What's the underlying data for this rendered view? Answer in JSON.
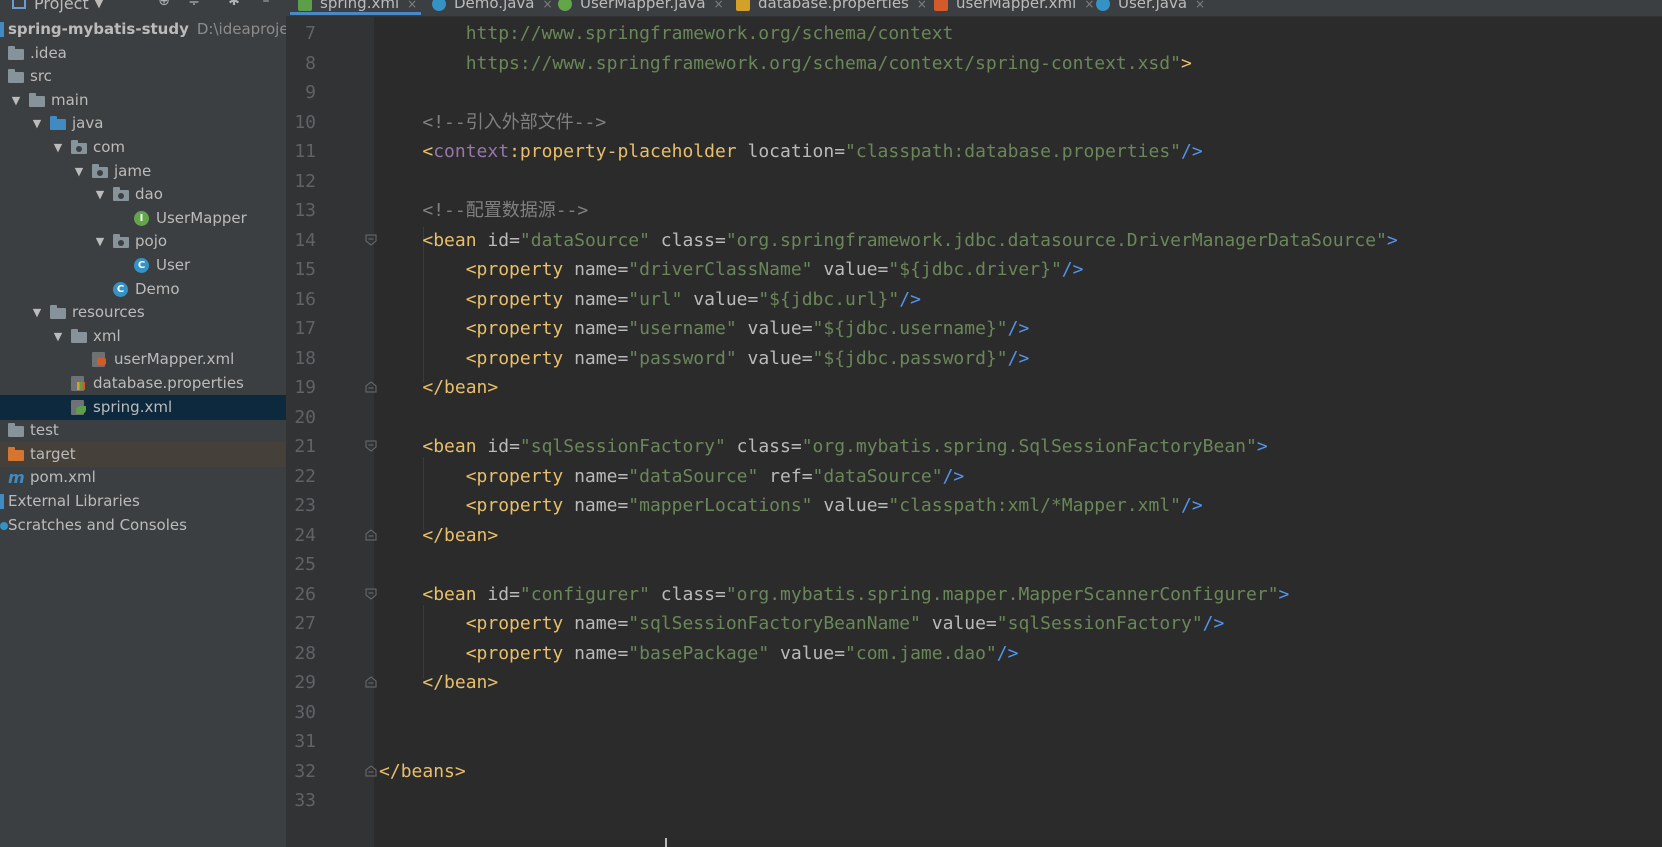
{
  "sidebar": {
    "toolbar_title": "Project",
    "rows": [
      {
        "label": "spring-mybatis-study",
        "muted": "D:\\ideaproject\\",
        "arrow": "",
        "icon": "module",
        "depth": 0
      },
      {
        "label": ".idea",
        "arrow": "",
        "icon": "folder",
        "depth": 0
      },
      {
        "label": "src",
        "arrow": "",
        "icon": "folder",
        "depth": 0
      },
      {
        "label": "main",
        "arrow": "▼",
        "icon": "folder",
        "depth": 1
      },
      {
        "label": "java",
        "arrow": "▼",
        "icon": "folder-blue",
        "depth": 2
      },
      {
        "label": "com",
        "arrow": "▼",
        "icon": "package",
        "depth": 3
      },
      {
        "label": "jame",
        "arrow": "▼",
        "icon": "package",
        "depth": 4
      },
      {
        "label": "dao",
        "arrow": "▼",
        "icon": "package",
        "depth": 5
      },
      {
        "label": "UserMapper",
        "arrow": "",
        "icon": "interface",
        "depth": 6
      },
      {
        "label": "pojo",
        "arrow": "▼",
        "icon": "package",
        "depth": 5
      },
      {
        "label": "User",
        "arrow": "",
        "icon": "class",
        "depth": 6
      },
      {
        "label": "Demo",
        "arrow": "",
        "icon": "class-main",
        "depth": 5
      },
      {
        "label": "resources",
        "arrow": "▼",
        "icon": "resources",
        "depth": 2
      },
      {
        "label": "xml",
        "arrow": "▼",
        "icon": "folder",
        "depth": 3
      },
      {
        "label": "userMapper.xml",
        "arrow": "",
        "icon": "xml",
        "depth": 4
      },
      {
        "label": "database.properties",
        "arrow": "",
        "icon": "properties",
        "depth": 3
      },
      {
        "label": "spring.xml",
        "arrow": "",
        "icon": "spring-xml",
        "depth": 3,
        "selected": true
      },
      {
        "label": "test",
        "arrow": "▶",
        "icon": "folder",
        "depth": 0
      },
      {
        "label": "target",
        "arrow": "",
        "icon": "folder-orange",
        "depth": 0,
        "highlight": true
      },
      {
        "label": "pom.xml",
        "arrow": "",
        "icon": "maven",
        "depth": 0
      },
      {
        "label": "External Libraries",
        "arrow": "",
        "icon": "libraries",
        "depth": -1
      },
      {
        "label": "Scratches and Consoles",
        "arrow": "",
        "icon": "scratches",
        "depth": -1
      }
    ]
  },
  "tabs": [
    {
      "label": "spring.xml",
      "icon": "spring-xml",
      "active": true
    },
    {
      "label": "Demo.java",
      "icon": "class"
    },
    {
      "label": "UserMapper.java",
      "icon": "interface"
    },
    {
      "label": "database.properties",
      "icon": "properties"
    },
    {
      "label": "userMapper.xml",
      "icon": "xml"
    },
    {
      "label": "User.java",
      "icon": "class"
    }
  ],
  "editor": {
    "lines": [
      {
        "n": "7",
        "fold": "",
        "tokens": [
          [
            "        ",
            ""
          ],
          [
            "http://www.springframework.org/schema/context",
            "url"
          ]
        ]
      },
      {
        "n": "8",
        "fold": "",
        "tokens": [
          [
            "        ",
            ""
          ],
          [
            "https://www.springframework.org/schema/context/spring-context.xsd\"",
            "url"
          ],
          [
            ">",
            "bracket"
          ]
        ]
      },
      {
        "n": "9",
        "fold": "",
        "tokens": []
      },
      {
        "n": "10",
        "fold": "",
        "tokens": [
          [
            "    ",
            ""
          ],
          [
            "<!--引入外部文件-->",
            "comment"
          ]
        ]
      },
      {
        "n": "11",
        "fold": "",
        "tokens": [
          [
            "    ",
            ""
          ],
          [
            "<",
            "bracket"
          ],
          [
            "context",
            "ns"
          ],
          [
            ":",
            "tag"
          ],
          [
            "property-placeholder",
            "tag"
          ],
          [
            " location",
            "attr"
          ],
          [
            "=",
            "attr"
          ],
          [
            "\"classpath:database.properties\"",
            "val"
          ],
          [
            "/>",
            "bracket-blue"
          ]
        ]
      },
      {
        "n": "12",
        "fold": "",
        "tokens": []
      },
      {
        "n": "13",
        "fold": "",
        "tokens": [
          [
            "    ",
            ""
          ],
          [
            "<!--配置数据源-->",
            "comment"
          ]
        ]
      },
      {
        "n": "14",
        "fold": "open",
        "tokens": [
          [
            "    ",
            ""
          ],
          [
            "<",
            "bracket"
          ],
          [
            "bean",
            "tag"
          ],
          [
            " id",
            "attr"
          ],
          [
            "=",
            "attr"
          ],
          [
            "\"dataSource\"",
            "val"
          ],
          [
            " class",
            "attr"
          ],
          [
            "=",
            "attr"
          ],
          [
            "\"org.springframework.jdbc.datasource.DriverManagerDataSource\"",
            "val"
          ],
          [
            ">",
            "bracket-blue"
          ]
        ]
      },
      {
        "n": "15",
        "fold": "",
        "tokens": [
          [
            "        ",
            ""
          ],
          [
            "<",
            "bracket"
          ],
          [
            "property",
            "tag"
          ],
          [
            " name",
            "attr"
          ],
          [
            "=",
            "attr"
          ],
          [
            "\"driverClassName\"",
            "val"
          ],
          [
            " value",
            "attr"
          ],
          [
            "=",
            "attr"
          ],
          [
            "\"${jdbc.driver}\"",
            "val"
          ],
          [
            "/>",
            "bracket-blue"
          ]
        ]
      },
      {
        "n": "16",
        "fold": "",
        "tokens": [
          [
            "        ",
            ""
          ],
          [
            "<",
            "bracket"
          ],
          [
            "property",
            "tag"
          ],
          [
            " name",
            "attr"
          ],
          [
            "=",
            "attr"
          ],
          [
            "\"url\"",
            "val"
          ],
          [
            " value",
            "attr"
          ],
          [
            "=",
            "attr"
          ],
          [
            "\"${jdbc.url}\"",
            "val"
          ],
          [
            "/>",
            "bracket-blue"
          ]
        ]
      },
      {
        "n": "17",
        "fold": "",
        "tokens": [
          [
            "        ",
            ""
          ],
          [
            "<",
            "bracket"
          ],
          [
            "property",
            "tag"
          ],
          [
            " name",
            "attr"
          ],
          [
            "=",
            "attr"
          ],
          [
            "\"username\"",
            "val"
          ],
          [
            " value",
            "attr"
          ],
          [
            "=",
            "attr"
          ],
          [
            "\"${jdbc.username}\"",
            "val"
          ],
          [
            "/>",
            "bracket-blue"
          ]
        ]
      },
      {
        "n": "18",
        "fold": "",
        "tokens": [
          [
            "        ",
            ""
          ],
          [
            "<",
            "bracket"
          ],
          [
            "property",
            "tag"
          ],
          [
            " name",
            "attr"
          ],
          [
            "=",
            "attr"
          ],
          [
            "\"password\"",
            "val"
          ],
          [
            " value",
            "attr"
          ],
          [
            "=",
            "attr"
          ],
          [
            "\"${jdbc.password}\"",
            "val"
          ],
          [
            "/>",
            "bracket-blue"
          ]
        ]
      },
      {
        "n": "19",
        "fold": "close",
        "tokens": [
          [
            "    ",
            ""
          ],
          [
            "</",
            "bracket"
          ],
          [
            "bean",
            "tag"
          ],
          [
            ">",
            "bracket"
          ]
        ]
      },
      {
        "n": "20",
        "fold": "",
        "tokens": []
      },
      {
        "n": "21",
        "fold": "open",
        "tokens": [
          [
            "    ",
            ""
          ],
          [
            "<",
            "bracket"
          ],
          [
            "bean",
            "tag"
          ],
          [
            " id",
            "attr"
          ],
          [
            "=",
            "attr"
          ],
          [
            "\"sqlSessionFactory\"",
            "val"
          ],
          [
            " class",
            "attr"
          ],
          [
            "=",
            "attr"
          ],
          [
            "\"org.mybatis.spring.SqlSessionFactoryBean\"",
            "val"
          ],
          [
            ">",
            "bracket-blue"
          ]
        ]
      },
      {
        "n": "22",
        "fold": "",
        "tokens": [
          [
            "        ",
            ""
          ],
          [
            "<",
            "bracket"
          ],
          [
            "property",
            "tag"
          ],
          [
            " name",
            "attr"
          ],
          [
            "=",
            "attr"
          ],
          [
            "\"dataSource\"",
            "val"
          ],
          [
            " ref",
            "attr"
          ],
          [
            "=",
            "attr"
          ],
          [
            "\"dataSource\"",
            "val"
          ],
          [
            "/>",
            "bracket-blue"
          ]
        ]
      },
      {
        "n": "23",
        "fold": "",
        "tokens": [
          [
            "        ",
            ""
          ],
          [
            "<",
            "bracket"
          ],
          [
            "property",
            "tag"
          ],
          [
            " name",
            "attr"
          ],
          [
            "=",
            "attr"
          ],
          [
            "\"mapperLocations\"",
            "val"
          ],
          [
            " value",
            "attr"
          ],
          [
            "=",
            "attr"
          ],
          [
            "\"classpath:xml/*Mapper.xml\"",
            "val"
          ],
          [
            "/>",
            "bracket-blue"
          ]
        ]
      },
      {
        "n": "24",
        "fold": "close",
        "tokens": [
          [
            "    ",
            ""
          ],
          [
            "</",
            "bracket"
          ],
          [
            "bean",
            "tag"
          ],
          [
            ">",
            "bracket"
          ]
        ]
      },
      {
        "n": "25",
        "fold": "",
        "tokens": []
      },
      {
        "n": "26",
        "fold": "open",
        "tokens": [
          [
            "    ",
            ""
          ],
          [
            "<",
            "bracket"
          ],
          [
            "bean",
            "tag"
          ],
          [
            " id",
            "attr"
          ],
          [
            "=",
            "attr"
          ],
          [
            "\"configurer\"",
            "val"
          ],
          [
            " class",
            "attr"
          ],
          [
            "=",
            "attr"
          ],
          [
            "\"org.mybatis.spring.mapper.MapperScannerConfigurer\"",
            "val"
          ],
          [
            ">",
            "bracket-blue"
          ]
        ]
      },
      {
        "n": "27",
        "fold": "",
        "tokens": [
          [
            "        ",
            ""
          ],
          [
            "<",
            "bracket"
          ],
          [
            "property",
            "tag"
          ],
          [
            " name",
            "attr"
          ],
          [
            "=",
            "attr"
          ],
          [
            "\"sqlSessionFactoryBeanName\"",
            "val"
          ],
          [
            " value",
            "attr"
          ],
          [
            "=",
            "attr"
          ],
          [
            "\"sqlSessionFactory\"",
            "val"
          ],
          [
            "/>",
            "bracket-blue"
          ]
        ]
      },
      {
        "n": "28",
        "fold": "",
        "tokens": [
          [
            "        ",
            ""
          ],
          [
            "<",
            "bracket"
          ],
          [
            "property",
            "tag"
          ],
          [
            " name",
            "attr"
          ],
          [
            "=",
            "attr"
          ],
          [
            "\"basePackage\"",
            "val"
          ],
          [
            " value",
            "attr"
          ],
          [
            "=",
            "attr"
          ],
          [
            "\"com.jame.dao\"",
            "val"
          ],
          [
            "/>",
            "bracket-blue"
          ]
        ]
      },
      {
        "n": "29",
        "fold": "close",
        "tokens": [
          [
            "    ",
            ""
          ],
          [
            "</",
            "bracket"
          ],
          [
            "bean",
            "tag"
          ],
          [
            ">",
            "bracket"
          ]
        ]
      },
      {
        "n": "30",
        "fold": "",
        "tokens": []
      },
      {
        "n": "31",
        "fold": "",
        "tokens": []
      },
      {
        "n": "32",
        "fold": "close",
        "tokens": [
          [
            "</",
            "bracket"
          ],
          [
            "beans",
            "tag"
          ],
          [
            ">",
            "bracket"
          ]
        ]
      },
      {
        "n": "33",
        "fold": "",
        "tokens": []
      }
    ]
  },
  "colors": {
    "editor_bg": "#2b2b2b",
    "sidebar_bg": "#3c3f41",
    "selection": "#0d293e",
    "tag": "#e8bf6a",
    "attribute_value": "#6a8759",
    "comment": "#808080",
    "namespace": "#9876aa"
  }
}
